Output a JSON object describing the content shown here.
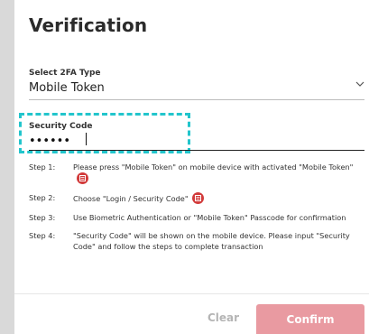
{
  "header": {
    "title": "Verification"
  },
  "select_2fa": {
    "label": "Select 2FA Type",
    "value": "Mobile Token"
  },
  "security_code": {
    "label": "Security Code",
    "value": "••••••"
  },
  "steps": [
    {
      "num": "Step 1:",
      "text": "Please press \"Mobile Token\" on mobile device with activated \"Mobile Token\""
    },
    {
      "num": "Step 2:",
      "text": "Choose \"Login / Security Code\""
    },
    {
      "num": "Step 3:",
      "text": "Use Biometric Authentication or \"Mobile Token\" Passcode for confirmation"
    },
    {
      "num": "Step 4:",
      "text": "\"Security Code\" will be shown on the mobile device. Please input \"Security Code\" and follow the steps to complete transaction"
    }
  ],
  "actions": {
    "clear_label": "Clear",
    "confirm_label": "Confirm"
  },
  "colors": {
    "highlight": "#22c5cc",
    "confirm_bg": "#e99aa1",
    "badge": "#d23b3b"
  },
  "icons": {
    "badge": "calculator-icon",
    "select": "chevron-down-icon"
  }
}
